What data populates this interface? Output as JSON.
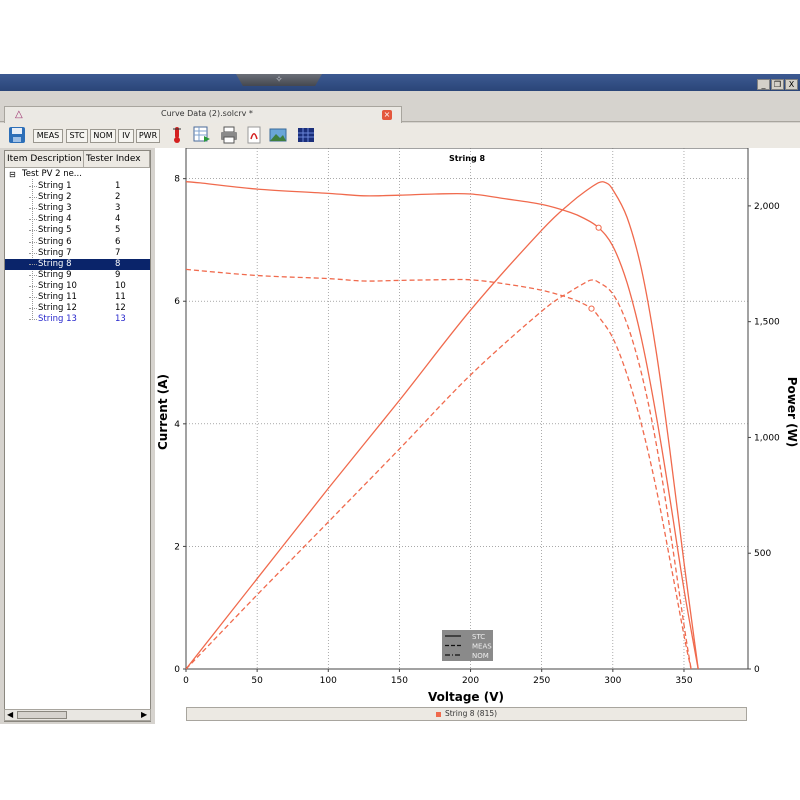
{
  "window": {
    "grip_label": "✧",
    "buttons": [
      "_",
      "❒",
      "X"
    ]
  },
  "document_tab": {
    "title": "Curve Data (2).solcrv *",
    "close_label": "×"
  },
  "toolbar": {
    "buttons": [
      {
        "name": "save-icon",
        "label": ""
      },
      {
        "name": "meas-button",
        "label": "MEAS"
      },
      {
        "name": "stc-button",
        "label": "STC"
      },
      {
        "name": "nom-button",
        "label": "NOM"
      },
      {
        "name": "iv-button",
        "label": "IV"
      },
      {
        "name": "pwr-button",
        "label": "PWR"
      }
    ],
    "icons": [
      "thermometer-icon",
      "export-grid-icon",
      "print-icon",
      "pdf-icon",
      "image-icon",
      "panel-icon"
    ]
  },
  "tree": {
    "columns": [
      "Item Description",
      "Tester Index"
    ],
    "root": "Test PV 2 ne...",
    "items": [
      {
        "label": "String 1",
        "index": "1"
      },
      {
        "label": "String 2",
        "index": "2"
      },
      {
        "label": "String 3",
        "index": "3"
      },
      {
        "label": "String 4",
        "index": "4"
      },
      {
        "label": "String 5",
        "index": "5"
      },
      {
        "label": "String 6",
        "index": "6"
      },
      {
        "label": "String 7",
        "index": "7"
      },
      {
        "label": "String 8",
        "index": "8"
      },
      {
        "label": "String 9",
        "index": "9"
      },
      {
        "label": "String 10",
        "index": "10"
      },
      {
        "label": "String 11",
        "index": "11"
      },
      {
        "label": "String 12",
        "index": "12"
      },
      {
        "label": "String 13",
        "index": "13"
      }
    ],
    "selected_index": 7,
    "highlight_index": 12
  },
  "legend_bar": {
    "label": "String 8 (815)",
    "color": "#f06a4d"
  },
  "chart_data": {
    "type": "line",
    "title": "String 8",
    "xlabel": "Voltage (V)",
    "ylabel_left": "Current (A)",
    "ylabel_right": "Power (W)",
    "xlim": [
      0,
      395
    ],
    "ylim_left": [
      0,
      8.5
    ],
    "ylim_right": [
      0,
      2250
    ],
    "x_ticks": [
      "0",
      "50",
      "100",
      "150",
      "200",
      "250",
      "300",
      "350"
    ],
    "y_ticks_left": [
      "0",
      "2",
      "4",
      "6",
      "8"
    ],
    "y_ticks_right": [
      "0",
      "500",
      "1,000",
      "1,500",
      "2,000"
    ],
    "grid": true,
    "color": "#f06a4d",
    "legend": {
      "position": "bottom-center",
      "entries": [
        {
          "label": "STC",
          "style": "solid"
        },
        {
          "label": "MEAS",
          "style": "dashed"
        },
        {
          "label": "NOM",
          "style": "dashdot"
        }
      ]
    },
    "series": [
      {
        "name": "STC",
        "axis": "left",
        "style": "solid",
        "x": [
          0,
          10,
          50,
          100,
          125,
          150,
          175,
          200,
          225,
          250,
          270,
          280,
          290,
          300,
          310,
          320,
          330,
          340,
          350,
          360
        ],
        "y": [
          7.95,
          7.93,
          7.83,
          7.76,
          7.72,
          7.73,
          7.75,
          7.75,
          7.67,
          7.58,
          7.45,
          7.35,
          7.2,
          6.9,
          6.3,
          5.4,
          4.2,
          2.8,
          1.3,
          0
        ]
      },
      {
        "name": "STC",
        "axis": "right",
        "style": "solid",
        "x": [
          0,
          50,
          100,
          150,
          200,
          250,
          270,
          280,
          290,
          295,
          300,
          310,
          320,
          330,
          340,
          350,
          360
        ],
        "y": [
          0,
          390,
          780,
          1160,
          1550,
          1895,
          2011,
          2060,
          2100,
          2100,
          2070,
          1950,
          1730,
          1390,
          950,
          460,
          0
        ]
      },
      {
        "name": "MEAS",
        "axis": "left",
        "style": "dashed",
        "x": [
          0,
          50,
          100,
          125,
          150,
          175,
          200,
          225,
          250,
          270,
          280,
          285,
          290,
          300,
          310,
          320,
          330,
          340,
          350,
          355
        ],
        "y": [
          6.52,
          6.42,
          6.37,
          6.33,
          6.34,
          6.35,
          6.35,
          6.28,
          6.18,
          6.05,
          5.95,
          5.88,
          5.75,
          5.4,
          4.8,
          4.0,
          3.0,
          1.8,
          0.55,
          0
        ]
      },
      {
        "name": "MEAS",
        "axis": "right",
        "style": "dashed",
        "x": [
          0,
          50,
          100,
          150,
          200,
          250,
          270,
          280,
          285,
          290,
          300,
          310,
          320,
          330,
          340,
          350,
          355
        ],
        "y": [
          0,
          320,
          635,
          950,
          1270,
          1545,
          1630,
          1666,
          1680,
          1670,
          1620,
          1490,
          1280,
          990,
          610,
          190,
          0
        ]
      }
    ],
    "markers": [
      {
        "series": "STC",
        "x": 290,
        "y": 7.2
      },
      {
        "series": "MEAS",
        "x": 285,
        "y": 5.88
      }
    ]
  }
}
